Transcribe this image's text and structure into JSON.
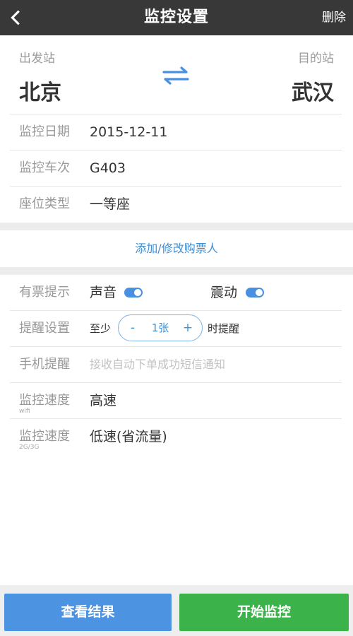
{
  "header": {
    "title": "监控设置",
    "delete_label": "删除"
  },
  "stations": {
    "from_label": "出发站",
    "from_city": "北京",
    "to_label": "目的站",
    "to_city": "武汉"
  },
  "details": {
    "date_label": "监控日期",
    "date_value": "2015-12-11",
    "train_label": "监控车次",
    "train_value": "G403",
    "seat_label": "座位类型",
    "seat_value": "一等座"
  },
  "passenger": {
    "add_label": "添加/修改购票人"
  },
  "alerts": {
    "ticket_label": "有票提示",
    "sound_label": "声音",
    "sound_on": true,
    "vibrate_label": "震动",
    "vibrate_on": true,
    "remind_label": "提醒设置",
    "remind_prefix": "至少",
    "remind_minus": "-",
    "remind_count": "1张",
    "remind_plus": "+",
    "remind_suffix": "时提醒",
    "phone_label": "手机提醒",
    "phone_placeholder": "接收自动下单成功短信通知",
    "speed_wifi_label": "监控速度",
    "speed_wifi_sub": "wifi",
    "speed_wifi_value": "高速",
    "speed_mobile_label": "监控速度",
    "speed_mobile_sub": "2G/3G",
    "speed_mobile_value": "低速(省流量)"
  },
  "actions": {
    "view_results": "查看结果",
    "start_monitor": "开始监控"
  },
  "colors": {
    "header_bg": "#383838",
    "accent_blue": "#4c93e2",
    "accent_green": "#3bb24a"
  },
  "icons": {
    "back": "chevron-left-icon",
    "swap": "swap-arrows-icon"
  }
}
